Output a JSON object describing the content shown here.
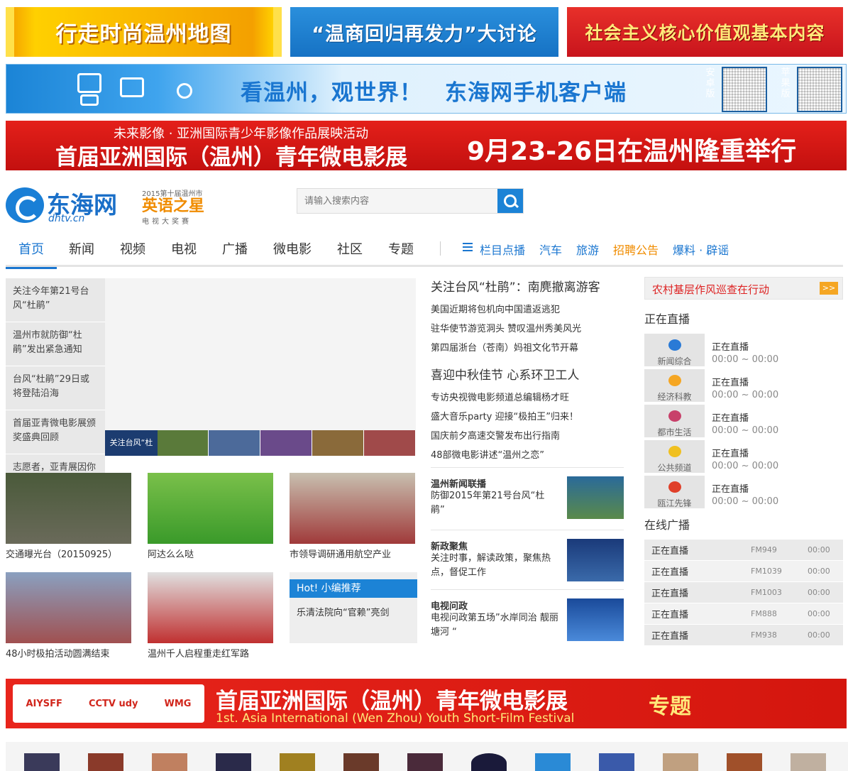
{
  "top_banners": {
    "a": "行走时尚温州地图",
    "b": "“温商回归再发力”大讨论",
    "c": "社会主义核心价值观基本内容"
  },
  "app_banner": {
    "text": "看温州，观世界！　东海网手机客户端",
    "android": "安卓版",
    "iphone": "苹果版"
  },
  "fest_banner": {
    "subtitle": "未来影像 · 亚洲国际青少年影像作品展映活动",
    "title": "首届亚洲国际（温州）青年微电影展",
    "date": "9月23-26日在温州隆重举行"
  },
  "header": {
    "logo_name": "东海网",
    "logo_domain": "dhtv.cn",
    "eng_top": "2015第十届温州市",
    "eng_main": "英语之星",
    "eng_bot": "电视大奖赛",
    "search_placeholder": "请输入搜索内容"
  },
  "nav": {
    "items": [
      "首页",
      "新闻",
      "视频",
      "电视",
      "广播",
      "微电影",
      "社区",
      "专题"
    ],
    "links": [
      "栏目点播",
      "汽车",
      "旅游",
      "招聘公告",
      "爆料 · 辟谣"
    ]
  },
  "topics": [
    "关注今年第21号台风“杜鹃”",
    "温州市就防御“杜鹃”发出紧急通知",
    "台风“杜鹃”29日或将登陆沿海",
    "首届亚青微电影展颁奖盛典回顾",
    "志愿者，亚青展因你而精彩"
  ],
  "slide_label": "关注台风“杜鹃”",
  "videos": [
    "交通曝光台（20150925）",
    "阿达么么哒",
    "市领导调研通用航空产业",
    "48小时极拍活动圆满结束",
    "温州千人启程重走红军路"
  ],
  "hot": {
    "head": "Hot! 小编推荐",
    "item": "乐清法院向“官赖”亮剑"
  },
  "news": {
    "head1": "关注台风“杜鹃”：南麂撤离游客",
    "list1": [
      "美国近期将包机向中国遣返逃犯",
      "驻华使节游览洞头 赞叹温州秀美风光",
      "第四届浙台（苍南）妈祖文化节开幕"
    ],
    "head2": "喜迎中秋佳节 心系环卫工人",
    "list2": [
      "专访央视微电影频道总编辑杨才旺",
      "盛大音乐party 迎接“极拍王”归来！",
      "国庆前夕高速交警发布出行指南",
      "48部微电影讲述“温州之恋”"
    ]
  },
  "features": [
    {
      "title": "温州新闻联播",
      "desc": "防御2015年第21号台风“杜鹃”"
    },
    {
      "title": "新政聚焦",
      "desc": "关注时事，解读政策，聚焦热点，督促工作"
    },
    {
      "title": "电视问政",
      "desc": "电视问政第五场”水岸同治 靓丽塘河 “"
    }
  ],
  "right": {
    "patrol": "农村基层作风巡查在行动",
    "patrol_btn": ">>",
    "live_title": "正在直播",
    "live": [
      {
        "channel": "新闻综合",
        "now": "正在直播",
        "time": "00:00 ~ 00:00"
      },
      {
        "channel": "经济科教",
        "now": "正在直播",
        "time": "00:00 ~ 00:00"
      },
      {
        "channel": "都市生活",
        "now": "正在直播",
        "time": "00:00 ~ 00:00"
      },
      {
        "channel": "公共频道",
        "now": "正在直播",
        "time": "00:00 ~ 00:00"
      },
      {
        "channel": "瓯江先锋",
        "now": "正在直播",
        "time": "00:00 ~ 00:00"
      }
    ],
    "radio_title": "在线广播",
    "radio": [
      {
        "now": "正在直播",
        "fm": "FM949",
        "time": "00:00"
      },
      {
        "now": "正在直播",
        "fm": "FM1039",
        "time": "00:00"
      },
      {
        "now": "正在直播",
        "fm": "FM1003",
        "time": "00:00"
      },
      {
        "now": "正在直播",
        "fm": "FM888",
        "time": "00:00"
      },
      {
        "now": "正在直播",
        "fm": "FM938",
        "time": "00:00"
      }
    ]
  },
  "bottom_fest": {
    "logo1": "AIYSFF",
    "logo2": "CCTV udy",
    "logo3": "WMG",
    "title": "首届亚洲国际（温州）青年微电影展",
    "tag": "专题",
    "en": "1st. Asia International (Wen Zhou) Youth Short-Film Festival"
  },
  "colors": {
    "brand": "#1a76d0",
    "accent_red": "#d4160e",
    "accent_orange": "#f08c00"
  }
}
